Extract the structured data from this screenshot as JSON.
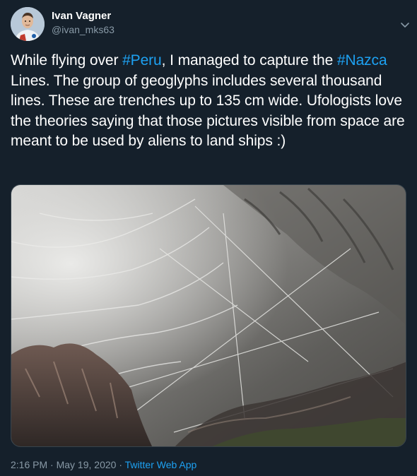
{
  "author": {
    "name": "Ivan Vagner",
    "handle": "@ivan_mks63",
    "avatar_icon": "astronaut-avatar"
  },
  "menu_icon": "chevron-down-icon",
  "tweet": {
    "segments": [
      {
        "text": "While flying over ",
        "type": "text"
      },
      {
        "text": "#Peru",
        "type": "hashtag"
      },
      {
        "text": ", I managed to capture the ",
        "type": "text"
      },
      {
        "text": "#Nazca",
        "type": "hashtag"
      },
      {
        "text": " Lines. The group of geoglyphs includes several thousand lines. These are trenches up to 135 cm wide. Ufologists love the theories saying that those pictures visible from space are meant to be used by aliens to land ships :)",
        "type": "text"
      }
    ]
  },
  "media": {
    "icon": "satellite-photo-nazca"
  },
  "meta": {
    "time": "2:16 PM",
    "separator": " · ",
    "date": "May 19, 2020",
    "source": "Twitter Web App"
  },
  "colors": {
    "background": "#15202b",
    "link": "#1da1f2",
    "secondary": "#8899a6"
  }
}
